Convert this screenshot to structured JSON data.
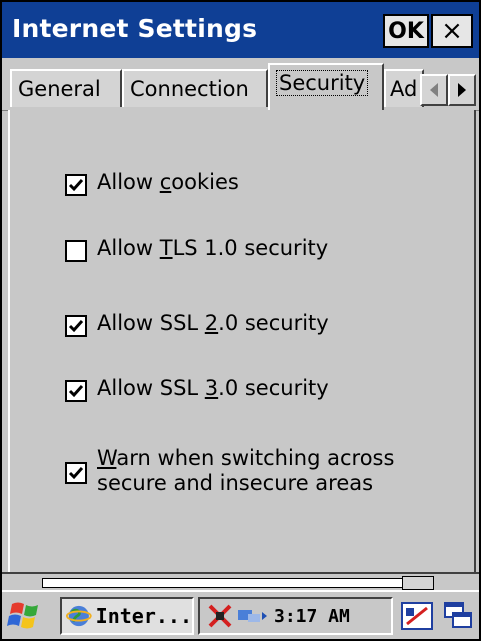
{
  "window": {
    "title": "Internet Settings",
    "ok_label": "OK",
    "close_label": "×"
  },
  "tabs": [
    {
      "label": "General",
      "active": false
    },
    {
      "label": "Connection",
      "active": false
    },
    {
      "label": "Security",
      "active": true
    },
    {
      "label": "Ad",
      "active": false
    }
  ],
  "options": [
    {
      "pre": "Allow ",
      "mn": "c",
      "post": "ookies",
      "checked": true
    },
    {
      "pre": "Allow ",
      "mn": "T",
      "post": "LS 1.0 security",
      "checked": false
    },
    {
      "pre": "Allow SSL ",
      "mn": "2",
      "post": ".0 security",
      "checked": true
    },
    {
      "pre": "Allow SSL ",
      "mn": "3",
      "post": ".0 security",
      "checked": true
    },
    {
      "pre": "",
      "mn": "W",
      "post": "arn when switching across",
      "line2": "secure and insecure areas",
      "checked": true
    }
  ],
  "taskbar": {
    "task_label": "Inter...",
    "clock": "3:17 AM"
  },
  "icons": {
    "start": "windows-start-icon",
    "ie": "internet-explorer-icon",
    "network": "network-disconnected-icon",
    "keyboard": "keyboard-icon",
    "switch": "window-switch-icon"
  },
  "colors": {
    "titlebar": "#0f3f95",
    "face": "#c8c8c8"
  }
}
